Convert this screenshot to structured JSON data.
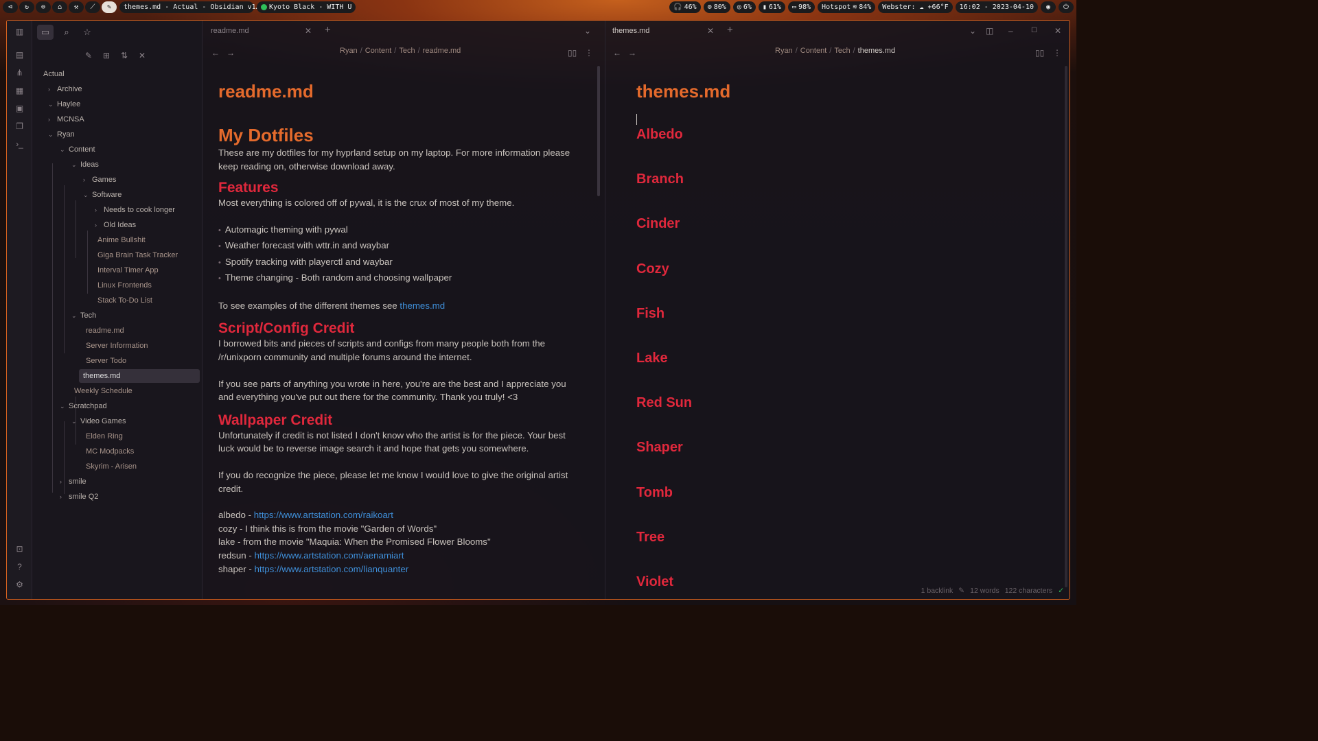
{
  "topbar": {
    "workspaces": [
      "⊲",
      "↻",
      "⊖",
      "⌂",
      "⚒",
      "⟋",
      "✎"
    ],
    "window_title": "themes.md - Actual - Obsidian v1…",
    "now_playing": "Kyoto Black - WITH U",
    "stats": [
      "46%",
      "80%",
      "6%",
      "61%",
      "98%"
    ],
    "network": "Hotspot",
    "wifi": "84%",
    "weather": "Webster: ☁ +66°F",
    "clock": "16:02 - 2023-04-10"
  },
  "sidebar": {
    "tree": [
      {
        "label": "Actual",
        "depth": 0,
        "type": "root"
      },
      {
        "label": "Archive",
        "depth": 0,
        "type": "folder",
        "open": false
      },
      {
        "label": "Haylee",
        "depth": 0,
        "type": "folder",
        "open": true
      },
      {
        "label": "MCNSA",
        "depth": 0,
        "type": "folder",
        "open": false
      },
      {
        "label": "Ryan",
        "depth": 0,
        "type": "folder",
        "open": true
      },
      {
        "label": "Content",
        "depth": 1,
        "type": "folder",
        "open": true
      },
      {
        "label": "Ideas",
        "depth": 2,
        "type": "folder",
        "open": true
      },
      {
        "label": "Games",
        "depth": 3,
        "type": "folder",
        "open": false
      },
      {
        "label": "Software",
        "depth": 3,
        "type": "folder",
        "open": true
      },
      {
        "label": "Needs to cook longer",
        "depth": 4,
        "type": "folder",
        "open": false
      },
      {
        "label": "Old Ideas",
        "depth": 4,
        "type": "folder",
        "open": false
      },
      {
        "label": "Anime Bullshit",
        "depth": 4,
        "type": "file"
      },
      {
        "label": "Giga Brain Task Tracker",
        "depth": 4,
        "type": "file"
      },
      {
        "label": "Interval Timer App",
        "depth": 4,
        "type": "file"
      },
      {
        "label": "Linux Frontends",
        "depth": 4,
        "type": "file"
      },
      {
        "label": "Stack To-Do List",
        "depth": 4,
        "type": "file"
      },
      {
        "label": "Tech",
        "depth": 2,
        "type": "folder",
        "open": true
      },
      {
        "label": "readme.md",
        "depth": 3,
        "type": "file"
      },
      {
        "label": "Server Information",
        "depth": 3,
        "type": "file"
      },
      {
        "label": "Server Todo",
        "depth": 3,
        "type": "file"
      },
      {
        "label": "themes.md",
        "depth": 3,
        "type": "file",
        "active": true
      },
      {
        "label": "Weekly Schedule",
        "depth": 2,
        "type": "file"
      },
      {
        "label": "Scratchpad",
        "depth": 1,
        "type": "folder",
        "open": true
      },
      {
        "label": "Video Games",
        "depth": 2,
        "type": "folder",
        "open": true
      },
      {
        "label": "Elden Ring",
        "depth": 3,
        "type": "file"
      },
      {
        "label": "MC Modpacks",
        "depth": 3,
        "type": "file"
      },
      {
        "label": "Skyrim - Arisen",
        "depth": 3,
        "type": "file"
      },
      {
        "label": "smile",
        "depth": 1,
        "type": "folder",
        "open": false
      },
      {
        "label": "smile Q2",
        "depth": 1,
        "type": "folder",
        "open": false
      }
    ]
  },
  "left": {
    "tab": "readme.md",
    "breadcrumb": [
      "Ryan",
      "Content",
      "Tech",
      "readme.md"
    ],
    "title": "readme.md",
    "h1": "My Dotfiles",
    "intro": "These are my dotfiles for my hyprland setup on my laptop. For more information please keep reading on, otherwise download away.",
    "features_h": "Features",
    "features_p": "Most everything is colored off of pywal, it is the crux of most of my theme.",
    "features": [
      "Automagic theming with pywal",
      "Weather forecast with wttr.in and waybar",
      "Spotify tracking with playerctl and waybar",
      "Theme changing - Both random and choosing wallpaper"
    ],
    "themes_p": "To see examples of the different themes see ",
    "themes_link": "themes.md",
    "credit_h": "Script/Config Credit",
    "credit_p1": "I borrowed bits and pieces of scripts and configs from many people both from the /r/unixporn community and multiple forums around the internet.",
    "credit_p2": "If you see parts of anything you wrote in here, you're are the best and I appreciate you and everything you've put out there for the community. Thank you truly! <3",
    "wall_h": "Wallpaper Credit",
    "wall_p1": "Unfortunately if credit is not listed I don't know who the artist is for the piece. Your best luck would be to reverse image search it and hope that gets you somewhere.",
    "wall_p2": "If you do recognize the piece, please let me know I would love to give the original artist credit.",
    "credits": [
      {
        "text": "albedo - ",
        "link": "https://www.artstation.com/raikoart"
      },
      {
        "text": "cozy - I think this is from the movie \"Garden of Words\"",
        "link": ""
      },
      {
        "text": "lake - from the movie \"Maquia: When the Promised Flower Blooms\"",
        "link": ""
      },
      {
        "text": "redsun - ",
        "link": "https://www.artstation.com/aenamiart"
      },
      {
        "text": "shaper - ",
        "link": "https://www.artstation.com/lianquanter"
      }
    ]
  },
  "right": {
    "tab": "themes.md",
    "breadcrumb": [
      "Ryan",
      "Content",
      "Tech",
      "themes.md"
    ],
    "title": "themes.md",
    "themes": [
      "Albedo",
      "Branch",
      "Cinder",
      "Cozy",
      "Fish",
      "Lake",
      "Red Sun",
      "Shaper",
      "Tomb",
      "Tree",
      "Violet"
    ]
  },
  "status": {
    "backlinks": "1 backlink",
    "words": "12 words",
    "chars": "122 characters"
  },
  "colors": {
    "accent": "#e46a2c",
    "heading": "#e0283c",
    "link": "#3f8fd9",
    "border": "#d9631f"
  }
}
